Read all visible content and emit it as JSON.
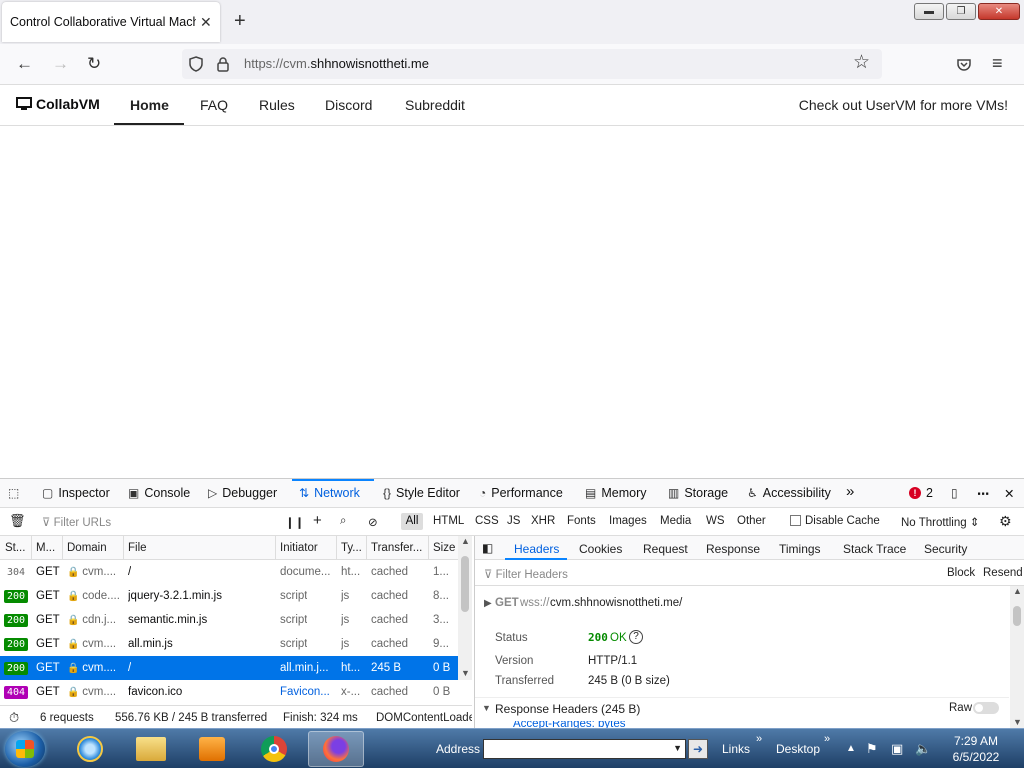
{
  "browser": {
    "tab_title": "Control Collaborative Virtual Machine",
    "tab_close": "✕",
    "new_tab": "+",
    "url_prefix": "https://cvm.",
    "url_domain": "shhnowisnottheti.me"
  },
  "site": {
    "brand": "CollabVM",
    "nav": [
      "Home",
      "FAQ",
      "Rules",
      "Discord",
      "Subreddit"
    ],
    "promo": "Check out UserVM for more VMs!"
  },
  "devtools": {
    "tabs": [
      "Inspector",
      "Console",
      "Debugger",
      "Network",
      "Style Editor",
      "Performance",
      "Memory",
      "Storage",
      "Accessibility"
    ],
    "error_count": "2",
    "filter_placeholder": "Filter URLs",
    "type_filters": [
      "All",
      "HTML",
      "CSS",
      "JS",
      "XHR",
      "Fonts",
      "Images",
      "Media",
      "WS",
      "Other"
    ],
    "disable_cache": "Disable Cache",
    "throttling": "No Throttling ⇕",
    "columns": [
      "St...",
      "M...",
      "Domain",
      "File",
      "Initiator",
      "Ty...",
      "Transfer...",
      "Size"
    ],
    "rows": [
      {
        "status": "304",
        "method": "GET",
        "domain": "cvm....",
        "file": "/",
        "initiator": "docume...",
        "type": "ht...",
        "transferred": "cached",
        "size": "1..."
      },
      {
        "status": "200",
        "method": "GET",
        "domain": "code....",
        "file": "jquery-3.2.1.min.js",
        "initiator": "script",
        "type": "js",
        "transferred": "cached",
        "size": "8..."
      },
      {
        "status": "200",
        "method": "GET",
        "domain": "cdn.j...",
        "file": "semantic.min.js",
        "initiator": "script",
        "type": "js",
        "transferred": "cached",
        "size": "3..."
      },
      {
        "status": "200",
        "method": "GET",
        "domain": "cvm....",
        "file": "all.min.js",
        "initiator": "script",
        "type": "js",
        "transferred": "cached",
        "size": "9..."
      },
      {
        "status": "200",
        "method": "GET",
        "domain": "cvm....",
        "file": "/",
        "initiator": "all.min.j...",
        "type": "ht...",
        "transferred": "245 B",
        "size": "0 B"
      },
      {
        "status": "404",
        "method": "GET",
        "domain": "cvm....",
        "file": "favicon.ico",
        "initiator": "Favicon...",
        "type": "x-...",
        "transferred": "cached",
        "size": "0 B"
      }
    ],
    "summary": {
      "requests": "6 requests",
      "size": "556.76 KB / 245 B transferred",
      "finish": "Finish: 324 ms",
      "dcl": "DOMContentLoaded"
    },
    "side": {
      "tabs": [
        "Headers",
        "Cookies",
        "Request",
        "Response",
        "Timings",
        "Stack Trace",
        "Security"
      ],
      "filter_placeholder": "Filter Headers",
      "block": "Block",
      "resend": "Resend",
      "request_method": "GET",
      "request_scheme": "wss://",
      "request_url": "cvm.shhnowisnottheti.me/",
      "status_label": "Status",
      "status_code": "200",
      "status_text": "OK",
      "version_label": "Version",
      "version_value": "HTTP/1.1",
      "transferred_label": "Transferred",
      "transferred_value": "245 B (0 B size)",
      "response_headers": "Response Headers (245 B)",
      "raw": "Raw",
      "partial_header": "Accept-Ranges: bytes"
    }
  },
  "taskbar": {
    "address_label": "Address",
    "links": "Links",
    "desktop": "Desktop",
    "time": "7:29 AM",
    "date": "6/5/2022"
  }
}
